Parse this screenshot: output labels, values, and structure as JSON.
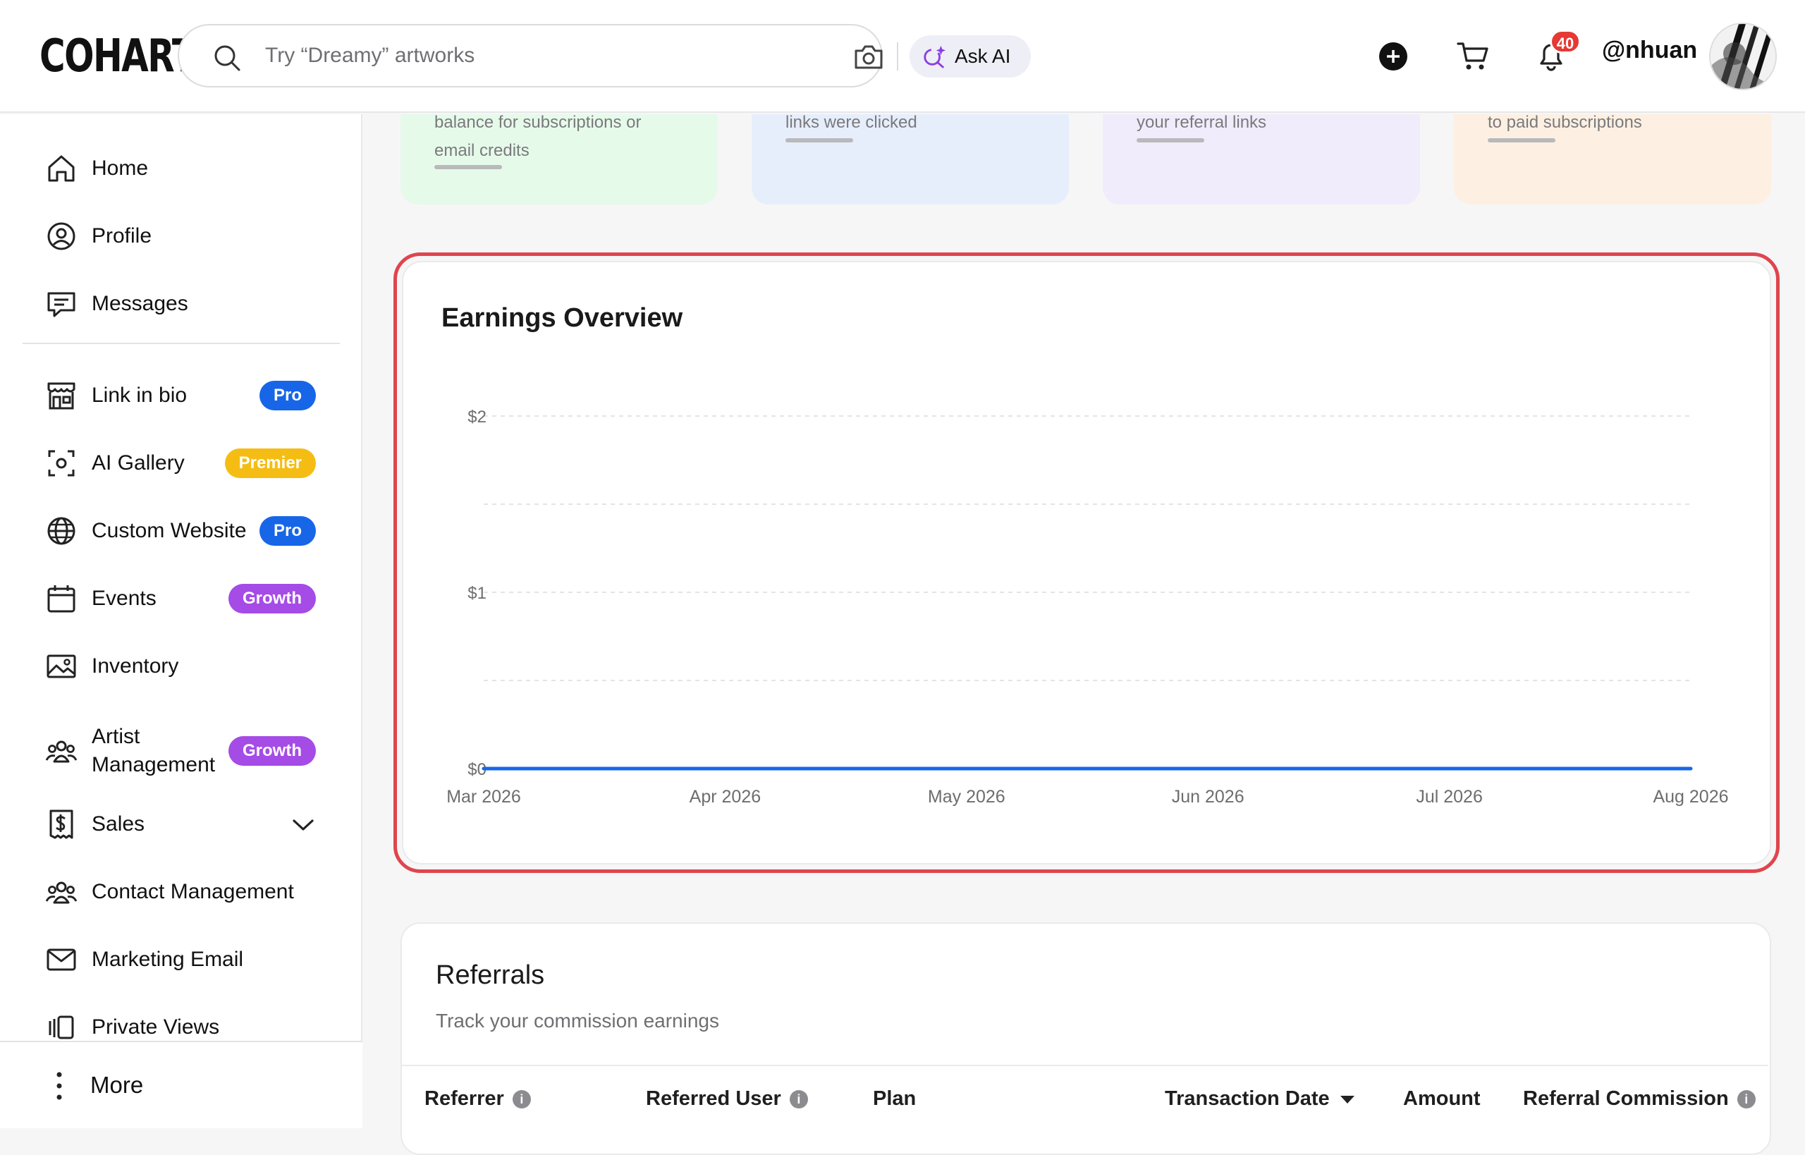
{
  "header": {
    "logo": "COHART",
    "search_placeholder": "Try “Dreamy” artworks",
    "ask_ai_label": "Ask AI",
    "notification_count": "40",
    "username": "@nhuan"
  },
  "sidebar": {
    "items": [
      {
        "label": "Home",
        "icon": "home-icon"
      },
      {
        "label": "Profile",
        "icon": "profile-icon"
      },
      {
        "label": "Messages",
        "icon": "messages-icon"
      },
      {
        "label": "Link in bio",
        "icon": "store-icon",
        "badge": "Pro"
      },
      {
        "label": "AI Gallery",
        "icon": "scan-icon",
        "badge": "Premier"
      },
      {
        "label": "Custom Website",
        "icon": "globe-icon",
        "badge": "Pro"
      },
      {
        "label": "Events",
        "icon": "calendar-icon",
        "badge": "Growth"
      },
      {
        "label": "Inventory",
        "icon": "image-icon"
      },
      {
        "label": "Artist Management",
        "icon": "users-icon",
        "badge": "Growth"
      },
      {
        "label": "Sales",
        "icon": "dollar-icon"
      },
      {
        "label": "Contact Management",
        "icon": "users-icon"
      },
      {
        "label": "Marketing Email",
        "icon": "mail-icon"
      },
      {
        "label": "Private Views",
        "icon": "views-icon"
      }
    ],
    "more_label": "More"
  },
  "stats": [
    {
      "text_line1": "balance for subscriptions or",
      "text_line2": "email credits",
      "color": "#e6faea"
    },
    {
      "text_line1": "links were clicked",
      "color": "#e6eefc"
    },
    {
      "text_line1": "your referral links",
      "color": "#f1ecfb"
    },
    {
      "text_line1": "to paid subscriptions",
      "color": "#fdf0e2"
    }
  ],
  "earnings": {
    "title": "Earnings Overview"
  },
  "chart_data": {
    "type": "line",
    "categories": [
      "Mar 2026",
      "Apr 2026",
      "May 2026",
      "Jun 2026",
      "Jul 2026",
      "Aug 2026"
    ],
    "series": [
      {
        "values": [
          0,
          0,
          0,
          0,
          0,
          0
        ],
        "color": "#1766e8"
      }
    ],
    "y_ticks": [
      "$0",
      "$1",
      "$2"
    ],
    "ylim": [
      0,
      2
    ],
    "grid": true
  },
  "referrals": {
    "title": "Referrals",
    "subtitle": "Track your commission earnings",
    "columns": [
      "Referrer",
      "Referred User",
      "Plan",
      "Transaction Date",
      "Amount",
      "Referral Commission"
    ]
  }
}
